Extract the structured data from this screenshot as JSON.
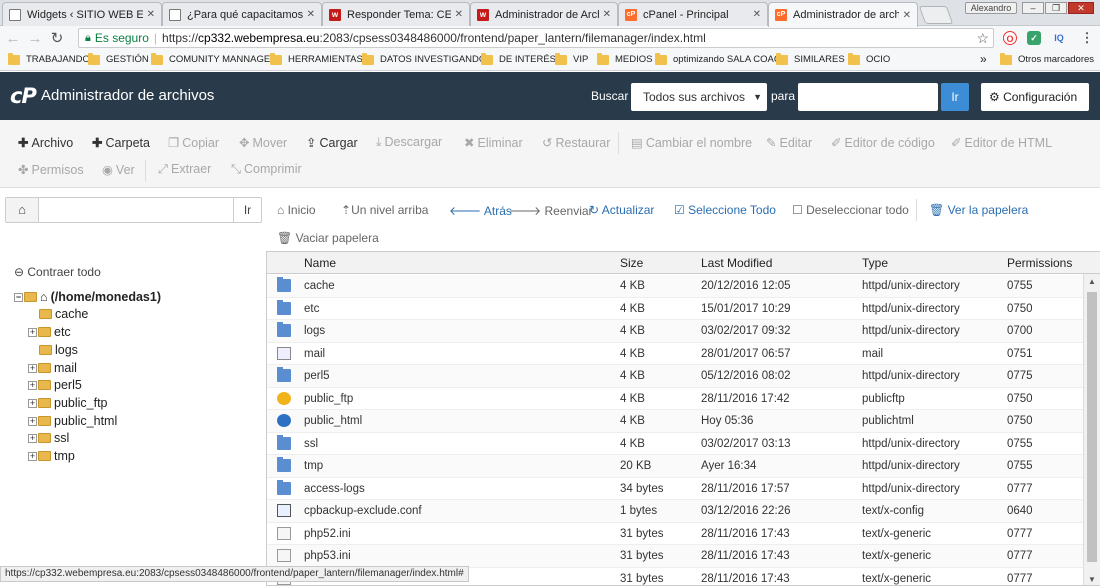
{
  "browser": {
    "tabs": [
      {
        "title": "Widgets ‹ SITIO WEB EN",
        "favicon": "doc"
      },
      {
        "title": "¿Para qué capacitamos a",
        "favicon": "doc"
      },
      {
        "title": "Responder Tema: CERTIF",
        "favicon": "w"
      },
      {
        "title": "Administrador de Archivo",
        "favicon": "w"
      },
      {
        "title": "cPanel - Principal",
        "favicon": "cp"
      },
      {
        "title": "Administrador de archivo",
        "favicon": "cp"
      }
    ],
    "user_label": "Alexandro",
    "secure_label": "Es seguro",
    "url_domain": "cp332.webempresa.eu",
    "url_prefix": "https://",
    "url_rest": ":2083/cpsess0348486000/frontend/paper_lantern/filemanager/index.html",
    "bookmarks": [
      "TRABAJANDO",
      "GESTIÓN",
      "COMUNITY MANNAGER",
      "HERRAMIENTAS",
      "DATOS INVESTIGANDO",
      "DE INTERÉS",
      "VIP",
      "MEDIOS",
      "optimizando SALA COAC",
      "SIMILARES",
      "OCIO"
    ],
    "bookmarks_more": "»",
    "other_bookmarks": "Otros marcadores",
    "status_url": "https://cp332.webempresa.eu:2083/cpsess0348486000/frontend/paper_lantern/filemanager/index.html#"
  },
  "header": {
    "logo": "cP",
    "title": "Administrador de archivos",
    "search_label": "Buscar",
    "search_scope": "Todos sus archivos",
    "for_label": "para",
    "go_label": "Ir",
    "settings_label": "Configuración"
  },
  "toolbar": {
    "row1": [
      "Archivo",
      "Carpeta",
      "Copiar",
      "Mover",
      "Cargar",
      "Descargar",
      "Eliminar",
      "Restaurar",
      "Cambiar el nombre",
      "Editar",
      "Editor de código",
      "Editor de HTML"
    ],
    "row2": [
      "Permisos",
      "Ver",
      "Extraer",
      "Comprimir"
    ]
  },
  "left": {
    "go_label": "Ir",
    "collapse_label": "Contraer todo",
    "root": "(/home/monedas1)",
    "tree": [
      "cache",
      "etc",
      "logs",
      "mail",
      "perl5",
      "public_ftp",
      "public_html",
      "ssl",
      "tmp"
    ]
  },
  "nav": {
    "home": "Inicio",
    "up": "Un nivel arriba",
    "back": "Atrás",
    "forward": "Reenviar",
    "refresh": "Actualizar",
    "select_all": "Seleccione Todo",
    "deselect_all": "Deseleccionar todo",
    "trash": "Ver la papelera",
    "empty_trash": "Vaciar papelera"
  },
  "table": {
    "headers": [
      "Name",
      "Size",
      "Last Modified",
      "Type",
      "Permissions"
    ],
    "rows": [
      {
        "name": "cache",
        "size": "4 KB",
        "modified": "20/12/2016 12:05",
        "type": "httpd/unix-directory",
        "perms": "0755",
        "icon": "folder-icon"
      },
      {
        "name": "etc",
        "size": "4 KB",
        "modified": "15/01/2017 10:29",
        "type": "httpd/unix-directory",
        "perms": "0750",
        "icon": "folder-icon"
      },
      {
        "name": "logs",
        "size": "4 KB",
        "modified": "03/02/2017 09:32",
        "type": "httpd/unix-directory",
        "perms": "0700",
        "icon": "folder-icon"
      },
      {
        "name": "mail",
        "size": "4 KB",
        "modified": "28/01/2017 06:57",
        "type": "mail",
        "perms": "0751",
        "icon": "mail-icon"
      },
      {
        "name": "perl5",
        "size": "4 KB",
        "modified": "05/12/2016 08:02",
        "type": "httpd/unix-directory",
        "perms": "0775",
        "icon": "folder-icon"
      },
      {
        "name": "public_ftp",
        "size": "4 KB",
        "modified": "28/11/2016 17:42",
        "type": "publicftp",
        "perms": "0750",
        "icon": "ftp-icon"
      },
      {
        "name": "public_html",
        "size": "4 KB",
        "modified": "Hoy 05:36",
        "type": "publichtml",
        "perms": "0750",
        "icon": "globe-icon"
      },
      {
        "name": "ssl",
        "size": "4 KB",
        "modified": "03/02/2017 03:13",
        "type": "httpd/unix-directory",
        "perms": "0755",
        "icon": "folder-icon"
      },
      {
        "name": "tmp",
        "size": "20 KB",
        "modified": "Ayer 16:34",
        "type": "httpd/unix-directory",
        "perms": "0755",
        "icon": "folder-icon"
      },
      {
        "name": "access-logs",
        "size": "34 bytes",
        "modified": "28/11/2016 17:57",
        "type": "httpd/unix-directory",
        "perms": "0777",
        "icon": "folder-icon"
      },
      {
        "name": "cpbackup-exclude.conf",
        "size": "1 bytes",
        "modified": "03/12/2016 22:26",
        "type": "text/x-config",
        "perms": "0640",
        "icon": "config-file-icon"
      },
      {
        "name": "php52.ini",
        "size": "31 bytes",
        "modified": "28/11/2016 17:43",
        "type": "text/x-generic",
        "perms": "0777",
        "icon": "text-file-icon"
      },
      {
        "name": "php53.ini",
        "size": "31 bytes",
        "modified": "28/11/2016 17:43",
        "type": "text/x-generic",
        "perms": "0777",
        "icon": "text-file-icon"
      },
      {
        "name": "",
        "size": "31 bytes",
        "modified": "28/11/2016 17:43",
        "type": "text/x-generic",
        "perms": "0777",
        "icon": "text-file-icon"
      }
    ]
  }
}
